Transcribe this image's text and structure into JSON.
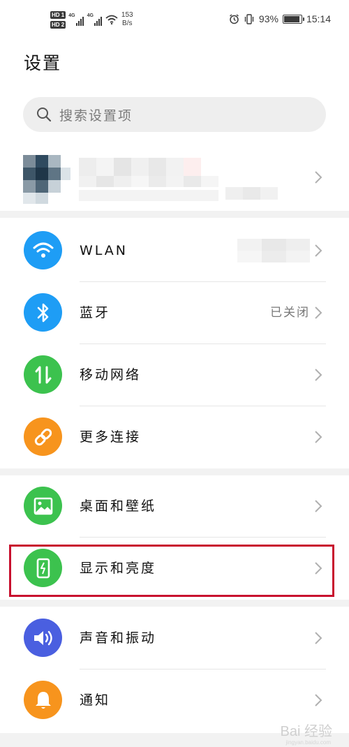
{
  "status_bar": {
    "hd_badges": [
      "HD 1",
      "HD 2"
    ],
    "network_1": "4G",
    "network_2": "4G",
    "speed_value": "153",
    "speed_unit": "B/s",
    "battery_percent": "93%",
    "battery_level": 0.93,
    "time": "15:14"
  },
  "page": {
    "title": "设置"
  },
  "search": {
    "placeholder": "搜索设置项"
  },
  "sections": [
    {
      "items": [
        {
          "label": "WLAN",
          "value": "",
          "icon": "wifi-icon",
          "color": "#1e9df5"
        },
        {
          "label": "蓝牙",
          "value": "已关闭",
          "icon": "bluetooth-icon",
          "color": "#1e9df5"
        },
        {
          "label": "移动网络",
          "value": "",
          "icon": "mobile-data-icon",
          "color": "#3cc24e"
        },
        {
          "label": "更多连接",
          "value": "",
          "icon": "link-icon",
          "color": "#f7941d"
        }
      ]
    },
    {
      "items": [
        {
          "label": "桌面和壁纸",
          "value": "",
          "icon": "wallpaper-icon",
          "color": "#3cc24e"
        },
        {
          "label": "显示和亮度",
          "value": "",
          "icon": "display-brightness-icon",
          "color": "#3cc24e"
        }
      ]
    },
    {
      "items": [
        {
          "label": "声音和振动",
          "value": "",
          "icon": "volume-icon",
          "color": "#4a5fe0"
        },
        {
          "label": "通知",
          "value": "",
          "icon": "notification-bell-icon",
          "color": "#f7941d"
        }
      ]
    }
  ],
  "watermark": {
    "text": "Bai 经验",
    "sub": "jingyan.baidu.com"
  }
}
